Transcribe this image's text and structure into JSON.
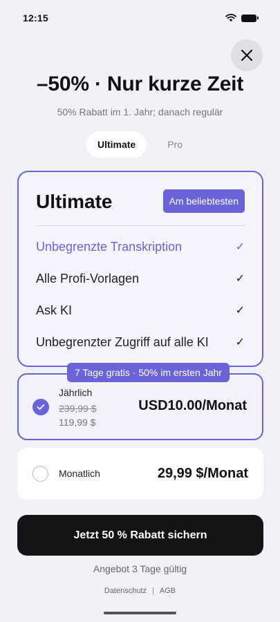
{
  "status_bar": {
    "time": "12:15"
  },
  "header": {
    "title": "–50% · Nur kurze Zeit",
    "subtitle": "50% Rabatt im 1. Jahr; danach regulär"
  },
  "tabs": [
    {
      "label": "Ultimate",
      "active": true
    },
    {
      "label": "Pro",
      "active": false
    }
  ],
  "plan": {
    "name": "Ultimate",
    "badge": "Am beliebtesten",
    "features": [
      {
        "label": "Unbegrenzte Transkription",
        "highlight": true
      },
      {
        "label": "Alle Profi-Vorlagen",
        "highlight": false
      },
      {
        "label": "Ask KI",
        "highlight": false
      },
      {
        "label": "Unbegrenzter Zugriff auf alle KI",
        "highlight": false
      }
    ],
    "check_glyph": "✓"
  },
  "options": {
    "offer_badge": "7 Tage gratis · 50% im ersten Jahr",
    "yearly": {
      "label": "Jährlich",
      "old_price": "239,99 $",
      "new_price": "119,99 $",
      "price": "USD10.00/Monat",
      "selected": true
    },
    "monthly": {
      "label": "Monatlich",
      "price": "29,99 $/Monat",
      "selected": false
    }
  },
  "cta": {
    "label": "Jetzt 50 % Rabatt sichern"
  },
  "valid_note": "Angebot 3 Tage gültig",
  "footer": {
    "privacy": "Datenschutz",
    "separator": "|",
    "terms": "AGB"
  },
  "colors": {
    "accent": "#6b63d9",
    "cta_bg": "#141414",
    "page_bg": "#f1f2f6"
  },
  "icons": {
    "close": "close-icon",
    "wifi": "wifi-icon",
    "battery": "battery-icon",
    "check": "check-icon"
  }
}
